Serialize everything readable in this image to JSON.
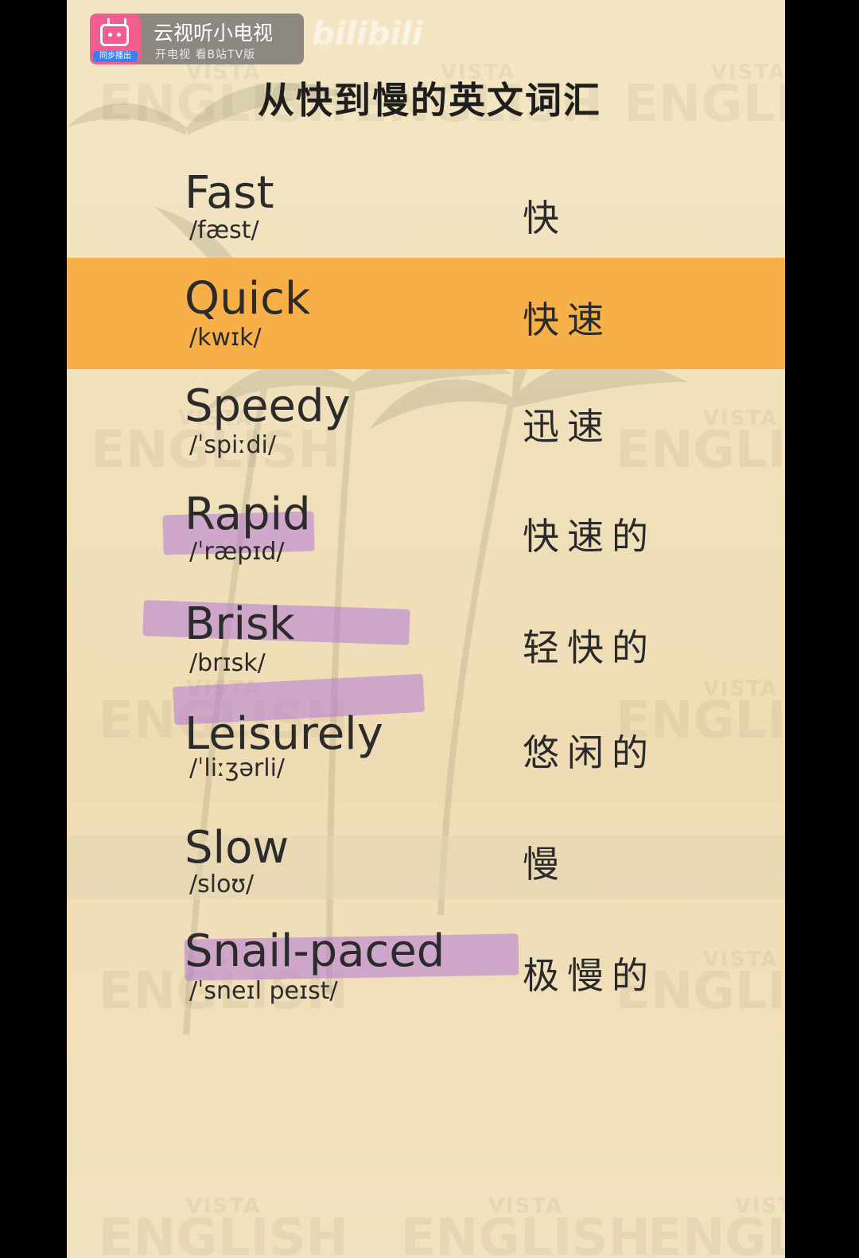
{
  "badge": {
    "app_name": "云视听小电视",
    "subtitle": "开电视 看B站TV版",
    "sync_label": "同步播出"
  },
  "watermark": {
    "brand": "bilibili",
    "vista": "VISTA",
    "english": "ENGLISH"
  },
  "title": "从快到慢的英文词汇",
  "vocab": [
    {
      "word": "Fast",
      "ipa": "/fæst/",
      "cn": "快"
    },
    {
      "word": "Quick",
      "ipa": "/kwɪk/",
      "cn": "快速"
    },
    {
      "word": "Speedy",
      "ipa": "/ˈspiːdi/",
      "cn": "迅速"
    },
    {
      "word": "Rapid",
      "ipa": "/ˈræpɪd/",
      "cn": "快速的"
    },
    {
      "word": "Brisk",
      "ipa": "/brɪsk/",
      "cn": "轻快的"
    },
    {
      "word": "Leisurely",
      "ipa": "/ˈliːʒərli/",
      "cn": "悠闲的"
    },
    {
      "word": "Slow",
      "ipa": "/sloʊ/",
      "cn": "慢"
    },
    {
      "word": "Snail-paced",
      "ipa": "/ˈsneɪl peɪst/",
      "cn": "极慢的"
    }
  ],
  "colors": {
    "highlight": "#f7b047",
    "marker": "#b278d7",
    "background": "#f4e6c4"
  },
  "icons": {
    "app_logo": "bilibili-tv-icon"
  }
}
